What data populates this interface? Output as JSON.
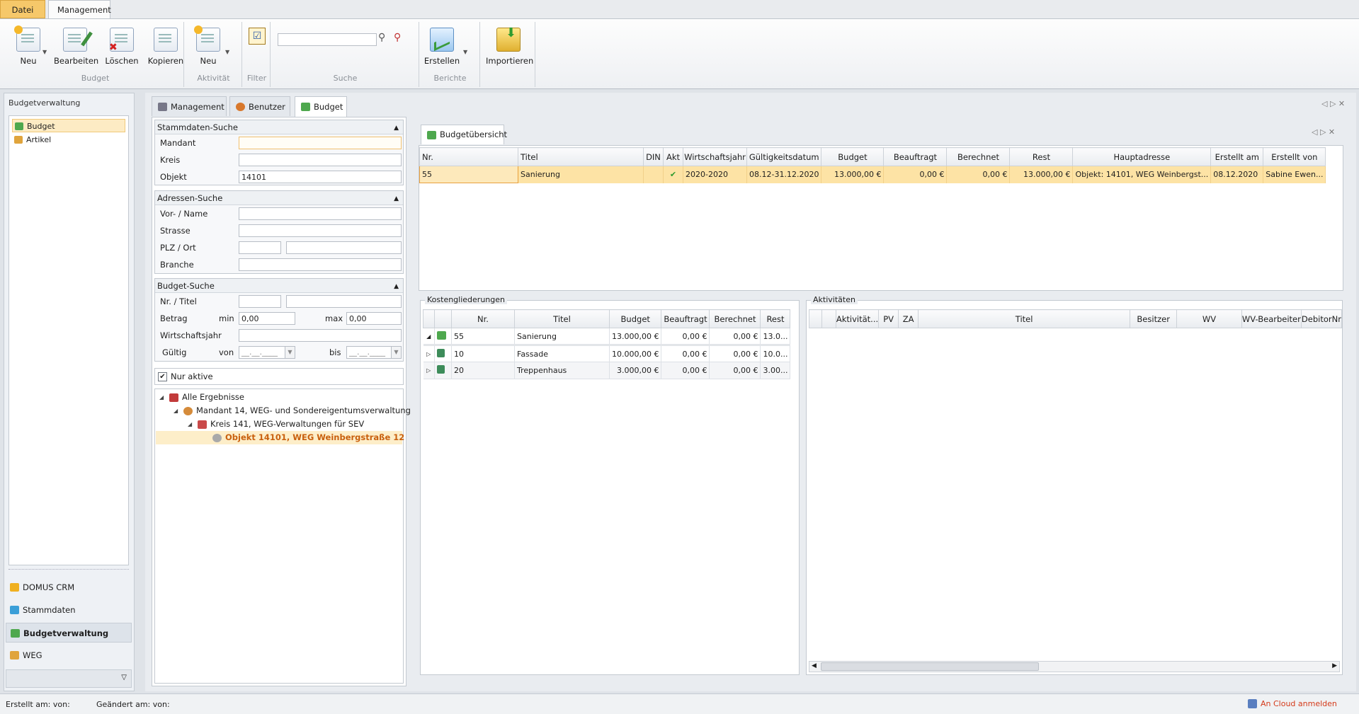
{
  "ribbon": {
    "tabs": [
      "Datei",
      "Management"
    ],
    "groups": {
      "budget": {
        "label": "Budget",
        "buttons": [
          "Neu",
          "Bearbeiten",
          "Löschen",
          "Kopieren"
        ]
      },
      "aktivitaet": {
        "label": "Aktivität",
        "buttons": [
          "Neu"
        ]
      },
      "filter": {
        "label": "Filter"
      },
      "suche": {
        "label": "Suche",
        "value": ""
      },
      "berichte": {
        "label": "Berichte",
        "buttons": [
          "Erstellen"
        ]
      },
      "import": {
        "buttons": [
          "Importieren"
        ]
      }
    }
  },
  "sidebar": {
    "title": "Budgetverwaltung",
    "items": [
      "Budget",
      "Artikel"
    ],
    "nav": [
      "DOMUS CRM",
      "Stammdaten",
      "Budgetverwaltung",
      "WEG"
    ]
  },
  "main_tabs": [
    "Management",
    "Benutzer",
    "Budget"
  ],
  "search": {
    "stammdaten": {
      "title": "Stammdaten-Suche",
      "mandant_label": "Mandant",
      "kreis_label": "Kreis",
      "objekt_label": "Objekt",
      "mandant": "",
      "kreis": "",
      "objekt": "14101"
    },
    "adressen": {
      "title": "Adressen-Suche",
      "name_label": "Vor- / Name",
      "strasse_label": "Strasse",
      "plz_label": "PLZ / Ort",
      "branche_label": "Branche"
    },
    "budget": {
      "title": "Budget-Suche",
      "nr_label": "Nr. / Titel",
      "betrag_label": "Betrag",
      "min_label": "min",
      "max_label": "max",
      "min": "0,00",
      "max": "0,00",
      "wj_label": "Wirtschaftsjahr",
      "gueltig_label": "Gültig",
      "von_label": "von",
      "bis_label": "bis",
      "von": "__.__.____",
      "bis": "__.__.____"
    },
    "nur_aktive": "Nur aktive"
  },
  "tree": {
    "root": "Alle Ergebnisse",
    "mandant": "Mandant 14, WEG- und Sondereigentumsverwaltung",
    "kreis": "Kreis 141, WEG-Verwaltungen für SEV",
    "objekt": "Objekt 14101, WEG Weinbergstraße 12"
  },
  "overview": {
    "tab": "Budgetübersicht",
    "columns": [
      "Nr.",
      "Titel",
      "DIN",
      "Akt",
      "Wirtschaftsjahr",
      "Gültigkeitsdatum",
      "Budget",
      "Beauftragt",
      "Berechnet",
      "Rest",
      "Hauptadresse",
      "Erstellt am",
      "Erstellt von"
    ],
    "rows": [
      {
        "nr": "55",
        "titel": "Sanierung",
        "din": "",
        "akt": "✔",
        "wj": "2020-2020",
        "gueltig": "08.12-31.12.2020",
        "budget": "13.000,00 €",
        "beauftragt": "0,00 €",
        "berechnet": "0,00 €",
        "rest": "13.000,00 €",
        "adresse": "Objekt: 14101, WEG Weinbergst...",
        "erstellt_am": "08.12.2020",
        "erstellt_von": "Sabine Ewen..."
      }
    ]
  },
  "kosten": {
    "title": "Kostengliederungen",
    "columns": [
      "Nr.",
      "Titel",
      "Budget",
      "Beauftragt",
      "Berechnet",
      "Rest"
    ],
    "parent": {
      "nr": "55",
      "titel": "Sanierung",
      "budget": "13.000,00 €",
      "beauftragt": "0,00 €",
      "berechnet": "0,00 €",
      "rest": "13.0..."
    },
    "children": [
      {
        "nr": "10",
        "titel": "Fassade",
        "budget": "10.000,00 €",
        "beauftragt": "0,00 €",
        "berechnet": "0,00 €",
        "rest": "10.0..."
      },
      {
        "nr": "20",
        "titel": "Treppenhaus",
        "budget": "3.000,00 €",
        "beauftragt": "0,00 €",
        "berechnet": "0,00 €",
        "rest": "3.00..."
      }
    ]
  },
  "aktivitaeten": {
    "title": "Aktivitäten",
    "columns": [
      "Aktivität...",
      "PV",
      "ZA",
      "Titel",
      "Besitzer",
      "WV",
      "WV-Bearbeiter",
      "DebitorNr"
    ]
  },
  "status": {
    "erstellt": "Erstellt am:  von:",
    "geaendert": "Geändert am:  von:",
    "cloud": "An Cloud anmelden"
  },
  "colors": {
    "accent": "#f6c86a",
    "selection": "#fde3a5",
    "brand_orange": "#c9600e"
  }
}
